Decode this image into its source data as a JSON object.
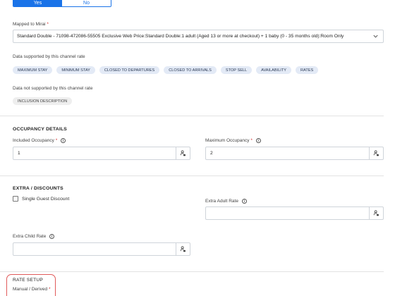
{
  "toggle": {
    "yes_label": "Yes",
    "no_label": "No"
  },
  "mapped": {
    "label": "Mapped to Mirai",
    "required": "*",
    "value": "Standard Double - 71098-472086-55505 Exclusive Web Price:Standard Double:1 adult (Aged 13 or more at checkout) + 1 baby (0 - 35 months old):Room Only"
  },
  "supported": {
    "label": "Data supported by this channel rate",
    "chips": [
      "Maximum Stay",
      "Minimum Stay",
      "Closed to Departures",
      "Closed to Arrivals",
      "Stop Sell",
      "Availability",
      "Rates"
    ]
  },
  "not_supported": {
    "label": "Data not supported by this channel rate",
    "chips": [
      "Inclusion Description"
    ]
  },
  "occupancy": {
    "title": "OCCUPANCY DETAILS",
    "included_label": "Included Occupancy",
    "included_value": "1",
    "maximum_label": "Maximum Occupancy",
    "maximum_value": "2",
    "required": "*"
  },
  "extra": {
    "title": "EXTRA / DISCOUNTS",
    "single_guest_label": "Single Guest Discount",
    "adult_rate_label": "Extra Adult Rate",
    "adult_rate_value": "",
    "child_rate_label": "Extra Child Rate",
    "child_rate_value": ""
  },
  "rate_setup": {
    "title": "RATE SETUP",
    "manual_label": "Manual / Derived",
    "required": "*"
  },
  "icons": {
    "info": "info-icon",
    "addon": "person-lock-icon",
    "chevron": "chevron-down-icon"
  },
  "colors": {
    "primary": "#1a73e8",
    "chip_bg": "#e3eaf6",
    "highlight": "#e05a5a"
  }
}
